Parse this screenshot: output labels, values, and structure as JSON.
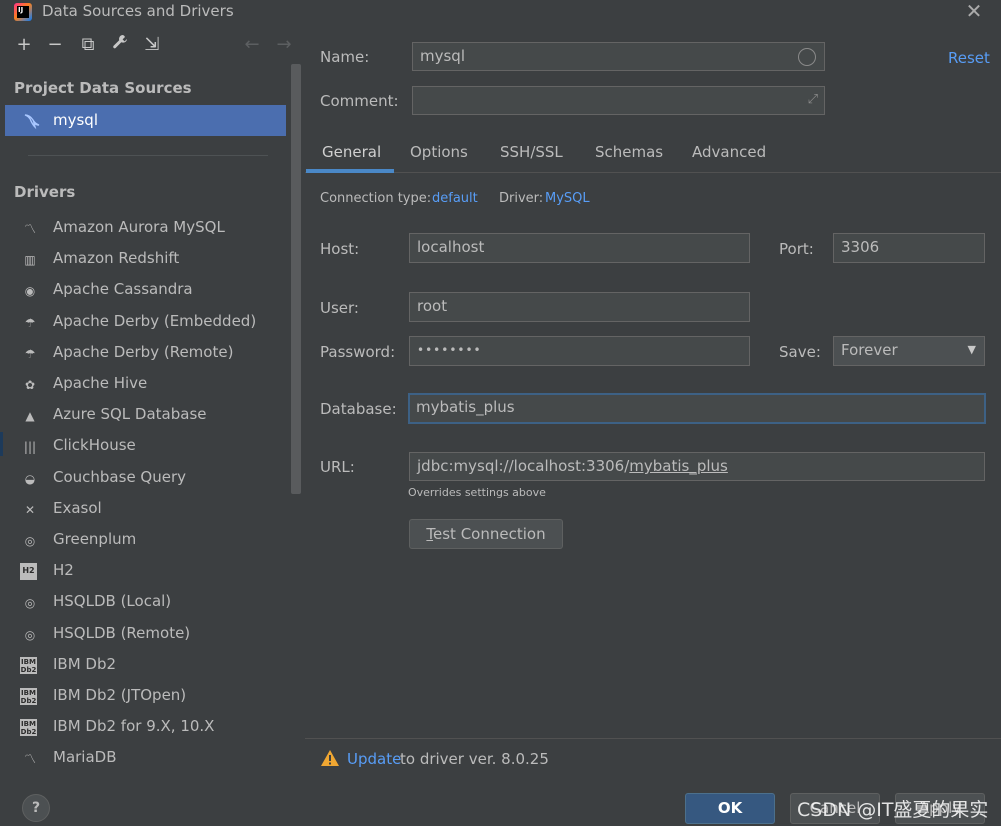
{
  "window": {
    "title": "Data Sources and Drivers",
    "logo_text": "IJ"
  },
  "toolbar": {
    "add": "+",
    "remove": "−",
    "copy": "⧉",
    "settings": "🔧",
    "import": "⇲",
    "back": "←",
    "forward": "→"
  },
  "sidebar": {
    "project_header": "Project Data Sources",
    "data_sources": [
      {
        "label": "mysql"
      }
    ],
    "drivers_header": "Drivers",
    "drivers": [
      {
        "label": "Amazon Aurora MySQL",
        "icon": "aurora-icon"
      },
      {
        "label": "Amazon Redshift",
        "icon": "redshift-icon"
      },
      {
        "label": "Apache Cassandra",
        "icon": "cassandra-icon"
      },
      {
        "label": "Apache Derby (Embedded)",
        "icon": "derby-icon"
      },
      {
        "label": "Apache Derby (Remote)",
        "icon": "derby-icon"
      },
      {
        "label": "Apache Hive",
        "icon": "hive-icon"
      },
      {
        "label": "Azure SQL Database",
        "icon": "azure-icon"
      },
      {
        "label": "ClickHouse",
        "icon": "clickhouse-icon"
      },
      {
        "label": "Couchbase Query",
        "icon": "couchbase-icon"
      },
      {
        "label": "Exasol",
        "icon": "exasol-icon"
      },
      {
        "label": "Greenplum",
        "icon": "greenplum-icon"
      },
      {
        "label": "H2",
        "icon": "h2-icon",
        "badge": "H2"
      },
      {
        "label": "HSQLDB (Local)",
        "icon": "hsqldb-icon"
      },
      {
        "label": "HSQLDB (Remote)",
        "icon": "hsqldb-icon"
      },
      {
        "label": "IBM Db2",
        "icon": "db2-icon",
        "badge": "IBM Db2"
      },
      {
        "label": "IBM Db2 (JTOpen)",
        "icon": "db2-icon",
        "badge": "IBM Db2"
      },
      {
        "label": "IBM Db2 for 9.X, 10.X",
        "icon": "db2-icon",
        "badge": "IBM Db2"
      },
      {
        "label": "MariaDB",
        "icon": "mariadb-icon"
      }
    ]
  },
  "form": {
    "name_label": "Name:",
    "name_value": "mysql",
    "reset": "Reset",
    "comment_label": "Comment:",
    "comment_value": "",
    "tabs": [
      "General",
      "Options",
      "SSH/SSL",
      "Schemas",
      "Advanced"
    ],
    "active_tab": "General",
    "connection_type_label": "Connection type:",
    "connection_type_value": "default",
    "driver_label": "Driver:",
    "driver_value": "MySQL",
    "host_label": "Host:",
    "host_value": "localhost",
    "port_label": "Port:",
    "port_value": "3306",
    "user_label": "User:",
    "user_value": "root",
    "password_label": "Password:",
    "password_value": "••••••••",
    "save_label": "Save:",
    "save_value": "Forever",
    "database_label": "Database:",
    "database_value": "mybatis_plus",
    "url_label": "URL:",
    "url_prefix": "jdbc:mysql://localhost:3306/",
    "url_db": "mybatis_plus",
    "url_hint": "Overrides settings above",
    "test_connection_T": "T",
    "test_connection_rest": "est Connection"
  },
  "notice": {
    "link": "Update",
    "text": " to driver ver. 8.0.25"
  },
  "footer": {
    "help": "?",
    "ok": "OK",
    "cancel": "Cancel",
    "apply": "Apply",
    "watermark": "CSDN @IT盛夏的果实"
  },
  "colors": {
    "background": "#3c3f41",
    "selection": "#4b6eaf",
    "link": "#589df6",
    "tab_underline": "#4a88c7",
    "ok_button": "#365880",
    "warning": "#f0a732"
  }
}
